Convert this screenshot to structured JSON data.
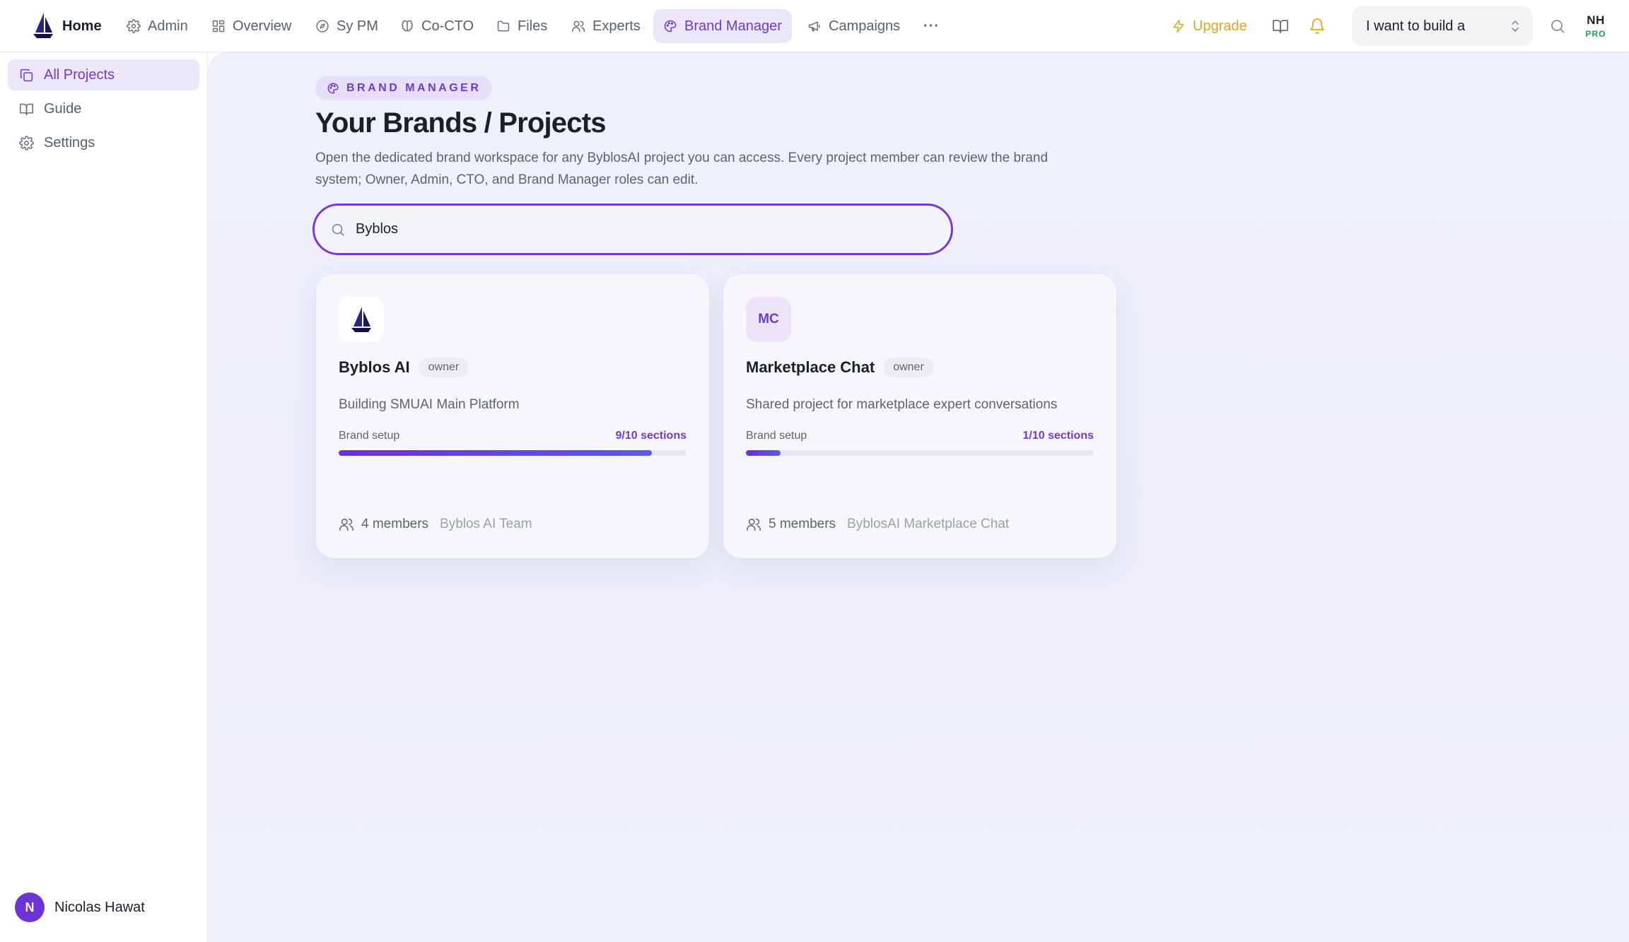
{
  "topnav": {
    "items": [
      {
        "label": "Home",
        "icon": "byblos-logo"
      },
      {
        "label": "Admin",
        "icon": "gear-icon"
      },
      {
        "label": "Overview",
        "icon": "layout-grid-icon"
      },
      {
        "label": "Sy PM",
        "icon": "compass-icon"
      },
      {
        "label": "Co-CTO",
        "icon": "brain-icon"
      },
      {
        "label": "Files",
        "icon": "folder-icon"
      },
      {
        "label": "Experts",
        "icon": "users-icon"
      },
      {
        "label": "Brand Manager",
        "icon": "palette-icon",
        "active": true
      },
      {
        "label": "Campaigns",
        "icon": "megaphone-icon"
      }
    ],
    "more_label": "···",
    "upgrade_label": "Upgrade",
    "build_select_value": "I want to build a",
    "avatar_initials": "NH",
    "avatar_badge": "PRO"
  },
  "sidebar": {
    "items": [
      {
        "label": "All Projects",
        "icon": "copy-icon",
        "active": true
      },
      {
        "label": "Guide",
        "icon": "book-open-icon"
      },
      {
        "label": "Settings",
        "icon": "gear-icon"
      }
    ],
    "user": {
      "initial": "N",
      "name": "Nicolas Hawat"
    }
  },
  "main": {
    "eyebrow": "BRAND MANAGER",
    "title": "Your Brands / Projects",
    "description": "Open the dedicated brand workspace for any ByblosAI project you can access. Every project member can review the brand system; Owner, Admin, CTO, and Brand Manager roles can edit.",
    "search": {
      "value": "Byblos",
      "placeholder": ""
    },
    "cards": [
      {
        "logo": "byblos-sail-logo",
        "name": "Byblos AI",
        "role": "owner",
        "description": "Building SMUAI Main Platform",
        "setup_label": "Brand setup",
        "setup_count": "9/10 sections",
        "progress": 0.9,
        "members": "4 members",
        "team": "Byblos AI Team"
      },
      {
        "logo_text": "MC",
        "name": "Marketplace Chat",
        "role": "owner",
        "description": "Shared project for marketplace expert conversations",
        "setup_label": "Brand setup",
        "setup_count": "1/10 sections",
        "progress": 0.1,
        "members": "5 members",
        "team": "ByblosAI Marketplace Chat"
      }
    ]
  },
  "colors": {
    "accent": "#6d3bd4",
    "upgrade": "#e0a522",
    "pro_badge": "#1f9d55",
    "main_bg": "#eef0fb"
  }
}
